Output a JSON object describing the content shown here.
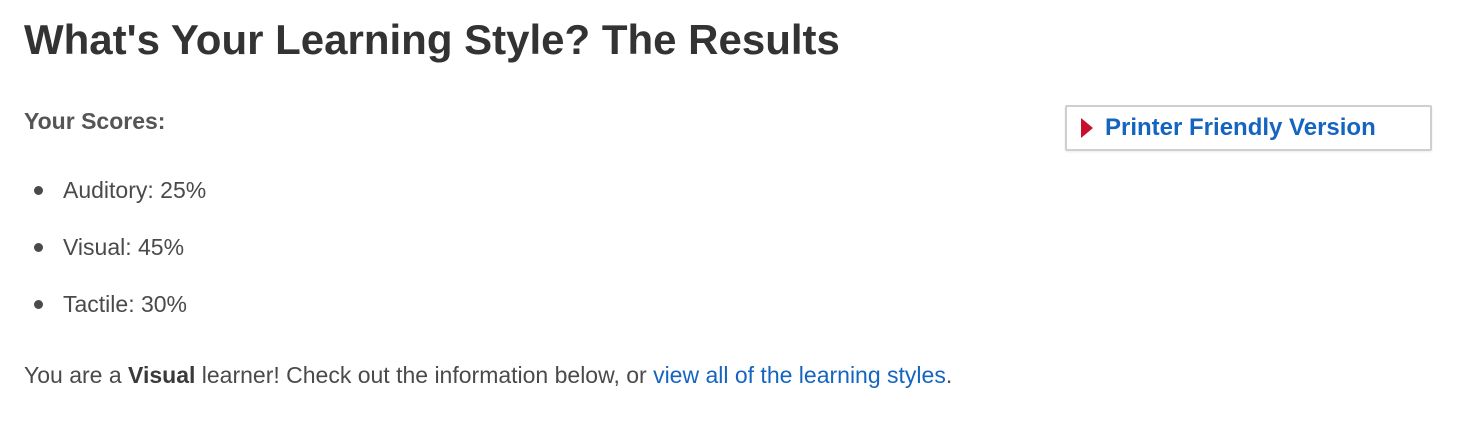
{
  "header": {
    "title": "What's Your Learning Style? The Results"
  },
  "scores": {
    "heading": "Your Scores:",
    "items": [
      {
        "label": "Auditory: 25%"
      },
      {
        "label": "Visual: 45%"
      },
      {
        "label": "Tactile: 30%"
      }
    ]
  },
  "printer_button": {
    "label": "Printer Friendly Version",
    "icon": "arrow-right-icon",
    "arrow_color": "#c8102e",
    "text_color": "#1565c0"
  },
  "result": {
    "prefix": "You are a ",
    "style": "Visual",
    "middle": " learner! Check out the information below, or ",
    "link_text": "view all of the learning styles",
    "suffix": "."
  },
  "colors": {
    "link": "#1565c0",
    "text": "#4a4a4a",
    "heading": "#333333"
  }
}
